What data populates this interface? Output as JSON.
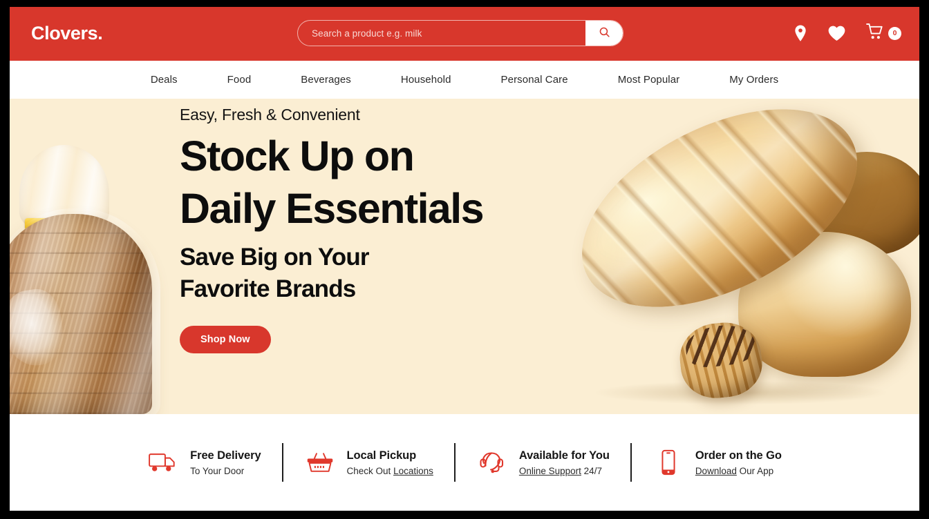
{
  "brand": {
    "name": "Clovers.",
    "primary_color": "#d8372c",
    "hero_bg_color": "#fbeed3"
  },
  "header": {
    "search": {
      "placeholder": "Search a product e.g. milk",
      "value": "",
      "button_icon": "search-icon"
    },
    "icons": [
      {
        "name": "location-pin-icon"
      },
      {
        "name": "heart-icon"
      },
      {
        "name": "cart-icon"
      }
    ],
    "cart_count": "0"
  },
  "nav": {
    "items": [
      {
        "label": "Deals"
      },
      {
        "label": "Food"
      },
      {
        "label": "Beverages"
      },
      {
        "label": "Household"
      },
      {
        "label": "Personal Care"
      },
      {
        "label": "Most Popular"
      },
      {
        "label": "My Orders"
      }
    ]
  },
  "hero": {
    "eyebrow": "Easy, Fresh & Convenient",
    "title_line1": "Stock Up on",
    "title_line2": "Daily Essentials",
    "subtitle_line1": "Save Big on Your",
    "subtitle_line2": "Favorite Brands",
    "cta_label": "Shop Now",
    "left_image_alt": "bagged-sliced-brown-bread",
    "right_image_alt": "bread-loaves-and-chocolate-croissant"
  },
  "features": [
    {
      "icon": "delivery-truck-icon",
      "title": "Free Delivery",
      "sub_prefix": "To Your Door",
      "sub_link": "",
      "sub_suffix": ""
    },
    {
      "icon": "shopping-basket-icon",
      "title": "Local Pickup",
      "sub_prefix": "Check Out ",
      "sub_link": "Locations",
      "sub_suffix": ""
    },
    {
      "icon": "headset-support-icon",
      "title": "Available for You",
      "sub_prefix": "",
      "sub_link": "Online Support",
      "sub_suffix": " 24/7"
    },
    {
      "icon": "mobile-phone-icon",
      "title": "Order on the Go",
      "sub_prefix": "",
      "sub_link": "Download",
      "sub_suffix": " Our App"
    }
  ]
}
